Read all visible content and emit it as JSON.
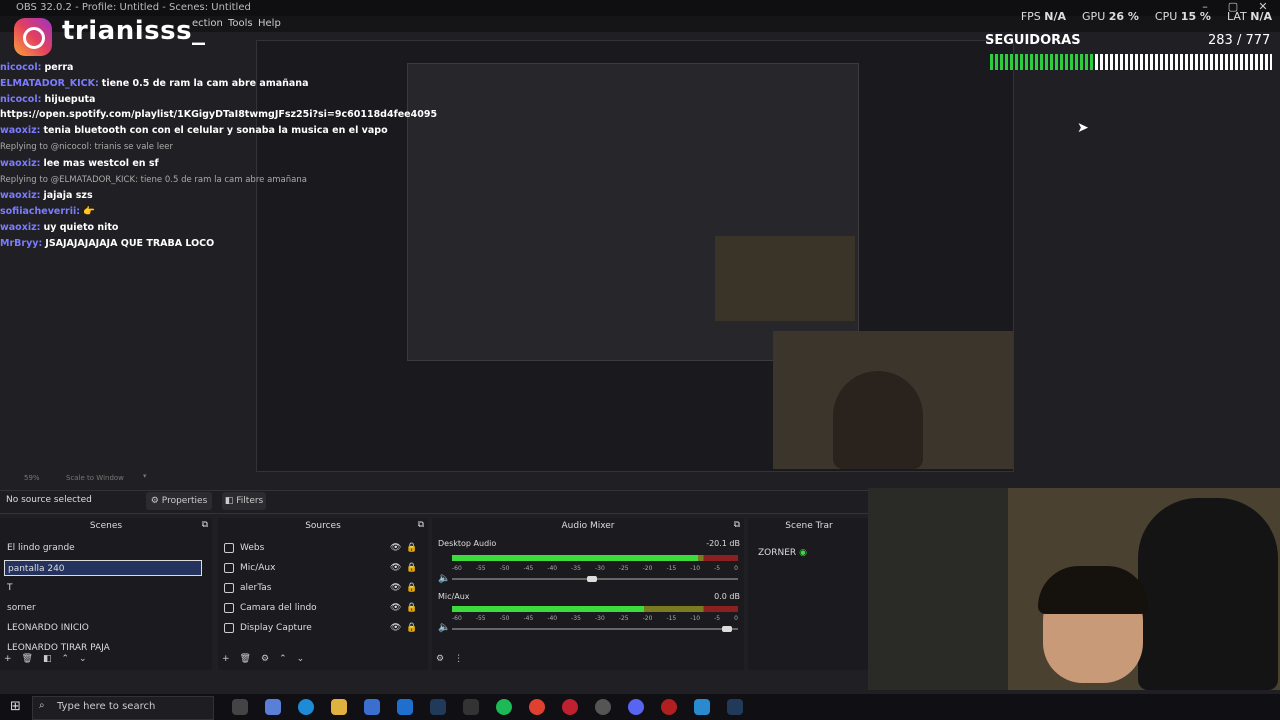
{
  "window": {
    "title": "OBS 32.0.2 - Profile: Untitled - Scenes: Untitled",
    "menu": [
      "ection",
      "Tools",
      "Help"
    ]
  },
  "stats": {
    "fps_label": "FPS",
    "fps_value": "N/A",
    "gpu_label": "GPU",
    "gpu_value": "26 %",
    "cpu_label": "CPU",
    "cpu_value": "15 %",
    "lat_label": "LAT",
    "lat_value": "N/A"
  },
  "overlay": {
    "handle": "trianisss_",
    "followers_label": "SEGUIDORAS",
    "followers_count": "283 / 777",
    "followers_progress": 0.364
  },
  "chat": [
    {
      "user": "nicocol:",
      "msg": "perra"
    },
    {
      "user": "ELMATADOR_KICK:",
      "msg": "tiene 0.5 de ram la cam abre amañana"
    },
    {
      "user": "nicocol:",
      "msg": "hijueputa"
    },
    {
      "user": "",
      "msg": "https://open.spotify.com/playlist/1KGigyDTaI8twmgJFsz25i?si=9c60118d4fee4095"
    },
    {
      "user": "waoxiz:",
      "msg": "tenia bluetooth con con el celular y sonaba la musica en el vapo"
    },
    {
      "reply": "Replying to @nicocol: trianis se vale leer"
    },
    {
      "user": "waoxiz:",
      "msg": "lee mas westcol en sf"
    },
    {
      "reply": "Replying to @ELMATADOR_KICK: tiene 0.5 de ram la cam abre amañana"
    },
    {
      "user": "waoxiz:",
      "msg": "jajaja szs"
    },
    {
      "user": "sofiiacheverrii:",
      "msg": "👉"
    },
    {
      "user": "waoxiz:",
      "msg": "uy quieto nito"
    },
    {
      "user": "MrBryy:",
      "msg": "JSAJAJAJAJAJA QUE TRABA LOCO"
    }
  ],
  "status_row": {
    "zoom": "59%",
    "scale": "Scale to Window"
  },
  "toolbar": {
    "no_source": "No source selected",
    "properties": "Properties",
    "filters": "Filters"
  },
  "scenes": {
    "title": "Scenes",
    "items": [
      "El lindo grande",
      "pantalla 240",
      "T",
      "sorner",
      "LEONARDO INICIO",
      "LEONARDO TIRAR PAJA"
    ],
    "selected_index": 1
  },
  "sources": {
    "title": "Sources",
    "items": [
      "Webs",
      "Mic/Aux",
      "alerTas",
      "Camara del lindo",
      "Display Capture"
    ]
  },
  "mixer": {
    "title": "Audio Mixer",
    "channels": [
      {
        "name": "Desktop Audio",
        "db": "-20.1 dB",
        "level": 0.86,
        "volume": 0.49
      },
      {
        "name": "Mic/Aux",
        "db": "0.0 dB",
        "level": 0.67,
        "volume": 0.98
      }
    ],
    "ticks": [
      "-60",
      "-55",
      "-50",
      "-45",
      "-40",
      "-35",
      "-30",
      "-25",
      "-20",
      "-15",
      "-10",
      "-5",
      "0"
    ]
  },
  "transitions": {
    "title": "Scene Trar",
    "item": "ZORNER"
  },
  "taskbar": {
    "search_placeholder": "Type here to search"
  },
  "colors": {
    "username": "#7b7cff",
    "selected_scene": "#24335e",
    "follower_bar_fill": "#2ecc40"
  }
}
